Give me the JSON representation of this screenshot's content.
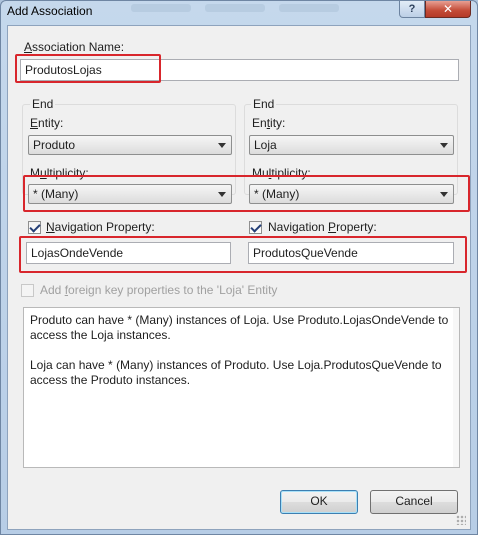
{
  "window": {
    "title": "Add Association",
    "help_glyph": "?",
    "close_glyph": "✕"
  },
  "association": {
    "name_label_prefix": "",
    "name_label_underlined": "A",
    "name_label_rest": "ssociation Name:",
    "name_value": "ProdutosLojas"
  },
  "end1": {
    "group_label": "End",
    "entity_label_u": "E",
    "entity_label_rest": "ntity:",
    "entity_value": "Produto",
    "multiplicity_label_pre": "M",
    "multiplicity_label_u": "u",
    "multiplicity_label_rest": "ltiplicity:",
    "multiplicity_value": "* (Many)",
    "nav_checked": true,
    "nav_label_u": "N",
    "nav_label_rest": "avigation Property:",
    "nav_value": "LojasOndeVende"
  },
  "end2": {
    "group_label": "End",
    "entity_label_pre": "En",
    "entity_label_u": "t",
    "entity_label_rest": "ity:",
    "entity_value": "Loja",
    "multiplicity_label_pre": "Mu",
    "multiplicity_label_u": "l",
    "multiplicity_label_rest": "tiplicity:",
    "multiplicity_value": "* (Many)",
    "nav_checked": true,
    "nav_label_pre": "Navigation ",
    "nav_label_u": "P",
    "nav_label_rest": "roperty:",
    "nav_value": "ProdutosQueVende"
  },
  "foreign_key": {
    "checked": false,
    "label_pre": "Add ",
    "label_u": "f",
    "label_rest": "oreign key properties to the 'Loja' Entity"
  },
  "description": {
    "para1": "Produto can have * (Many) instances of Loja. Use Produto.LojasOndeVende to access the Loja instances.",
    "para2": "Loja can have * (Many) instances of Produto. Use Loja.ProdutosQueVende to access the Produto instances."
  },
  "buttons": {
    "ok": "OK",
    "cancel": "Cancel"
  },
  "colors": {
    "highlight": "#d8262c",
    "window_frame": "#b7cde6",
    "dialog_bg": "#f0f0f0"
  }
}
